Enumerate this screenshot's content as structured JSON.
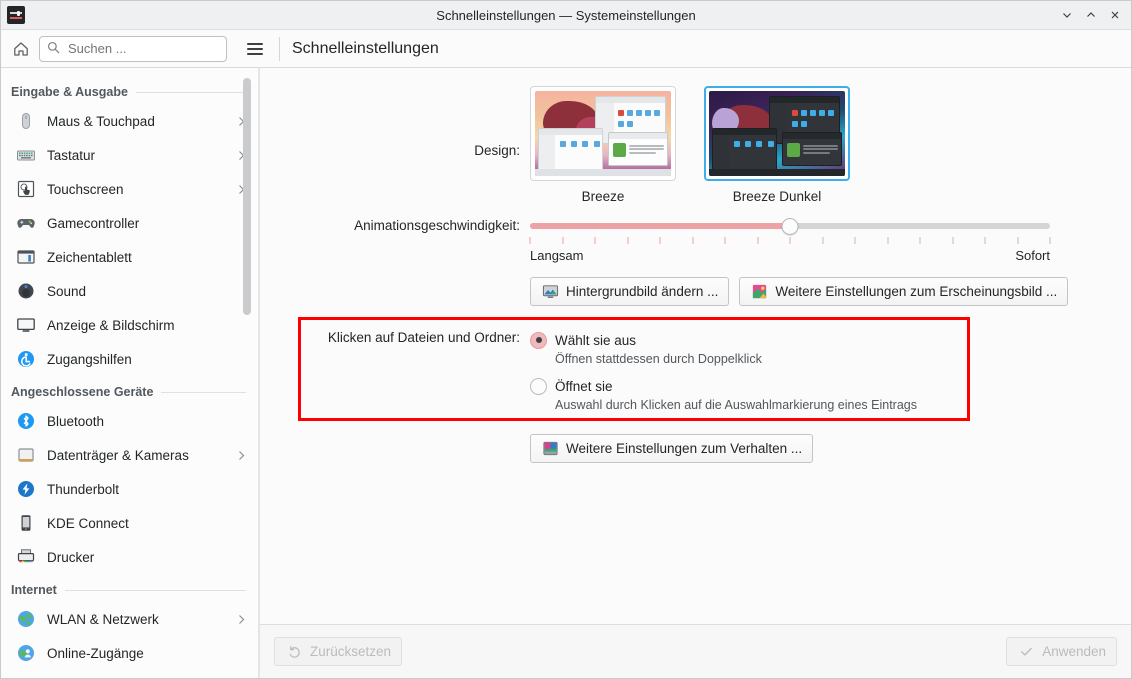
{
  "window": {
    "title": "Schnelleinstellungen — Systemeinstellungen",
    "app_icon": "settings-sliders-icon",
    "controls": {
      "minimize": "minimize",
      "maximize": "maximize",
      "close": "close"
    }
  },
  "toolbar": {
    "home_icon": "home-icon",
    "search": {
      "placeholder": "Suchen ...",
      "value": "",
      "icon": "search-icon"
    },
    "menu_icon": "hamburger-menu-icon",
    "page_title": "Schnelleinstellungen"
  },
  "sidebar": {
    "groups": [
      {
        "title": "Eingabe & Ausgabe",
        "items": [
          {
            "label": "Maus & Touchpad",
            "icon": "mouse-icon",
            "has_arrow": true
          },
          {
            "label": "Tastatur",
            "icon": "keyboard-icon",
            "has_arrow": true
          },
          {
            "label": "Touchscreen",
            "icon": "touchscreen-icon",
            "has_arrow": true
          },
          {
            "label": "Gamecontroller",
            "icon": "gamepad-icon",
            "has_arrow": false
          },
          {
            "label": "Zeichentablett",
            "icon": "drawing-tablet-icon",
            "has_arrow": false
          },
          {
            "label": "Sound",
            "icon": "speaker-icon",
            "has_arrow": false
          },
          {
            "label": "Anzeige & Bildschirm",
            "icon": "monitor-icon",
            "has_arrow": false
          },
          {
            "label": "Zugangshilfen",
            "icon": "accessibility-icon",
            "has_arrow": false
          }
        ]
      },
      {
        "title": "Angeschlossene Geräte",
        "items": [
          {
            "label": "Bluetooth",
            "icon": "bluetooth-icon",
            "has_arrow": false
          },
          {
            "label": "Datenträger & Kameras",
            "icon": "disk-icon",
            "has_arrow": true
          },
          {
            "label": "Thunderbolt",
            "icon": "thunderbolt-icon",
            "has_arrow": false
          },
          {
            "label": "KDE Connect",
            "icon": "phone-icon",
            "has_arrow": false
          },
          {
            "label": "Drucker",
            "icon": "printer-icon",
            "has_arrow": false
          }
        ]
      },
      {
        "title": "Internet",
        "items": [
          {
            "label": "WLAN & Netzwerk",
            "icon": "globe-icon",
            "has_arrow": true
          },
          {
            "label": "Online-Zugänge",
            "icon": "online-accounts-icon",
            "has_arrow": false
          }
        ]
      }
    ]
  },
  "main": {
    "design": {
      "label": "Design:",
      "options": [
        {
          "name": "Breeze",
          "selected": false
        },
        {
          "name": "Breeze Dunkel",
          "selected": true
        }
      ]
    },
    "animation": {
      "label": "Animationsgeschwindigkeit:",
      "min_label": "Langsam",
      "max_label": "Sofort",
      "value": 50,
      "min": 0,
      "max": 100,
      "tick_count": 17
    },
    "appearance_buttons": [
      {
        "label": "Hintergrundbild ändern ...",
        "icon": "wallpaper-icon"
      },
      {
        "label": "Weitere Einstellungen zum Erscheinungsbild ...",
        "icon": "appearance-icon"
      }
    ],
    "click_behavior": {
      "label": "Klicken auf Dateien und Ordner:",
      "options": [
        {
          "label": "Wählt sie aus",
          "description": "Öffnen stattdessen durch Doppelklick",
          "selected": true
        },
        {
          "label": "Öffnet sie",
          "description": "Auswahl durch Klicken auf die Auswahlmarkierung eines Eintrags",
          "selected": false
        }
      ]
    },
    "behavior_button": {
      "label": "Weitere Einstellungen zum Verhalten ...",
      "icon": "behavior-icon"
    }
  },
  "footer": {
    "reset": {
      "label": "Zurücksetzen",
      "icon": "undo-icon",
      "enabled": false
    },
    "apply": {
      "label": "Anwenden",
      "icon": "check-icon",
      "enabled": false
    }
  },
  "colors": {
    "highlight_box": "#ff0000",
    "selection_blue": "#3daee9",
    "slider_fill": "#eda2a6",
    "radio_fill": "#f2b9bd"
  }
}
